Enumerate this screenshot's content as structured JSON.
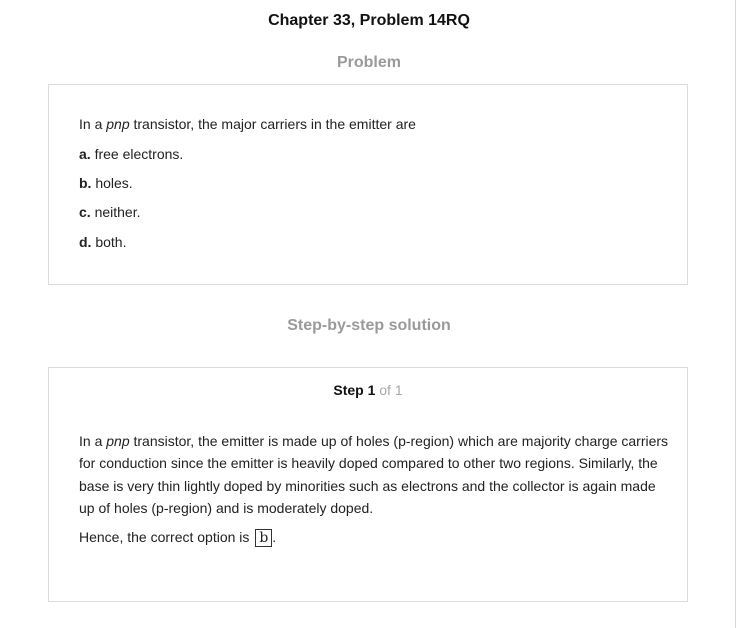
{
  "page": {
    "title": "Chapter 33, Problem 14RQ"
  },
  "problem": {
    "heading": "Problem",
    "question_prefix": "In a ",
    "question_italic": "pnp",
    "question_suffix": " transistor, the major carriers in the emitter are",
    "options": [
      {
        "letter": "a.",
        "text": " free electrons."
      },
      {
        "letter": "b.",
        "text": " holes."
      },
      {
        "letter": "c.",
        "text": " neither."
      },
      {
        "letter": "d.",
        "text": " both."
      }
    ]
  },
  "solution": {
    "heading": "Step-by-step solution",
    "step_label": "Step 1",
    "step_of": " of 1",
    "explanation_prefix": "In a ",
    "explanation_italic": "pnp",
    "explanation_suffix": " transistor, the emitter is made up of holes (p-region) which are majority charge carriers for conduction since the emitter is heavily doped compared to other two regions. Similarly, the base is very thin lightly doped by minorities such as electrons and the collector is again made up of holes (p-region) and is moderately doped.",
    "conclusion_text": "Hence, the correct option is ",
    "answer": "b",
    "conclusion_end": "."
  }
}
